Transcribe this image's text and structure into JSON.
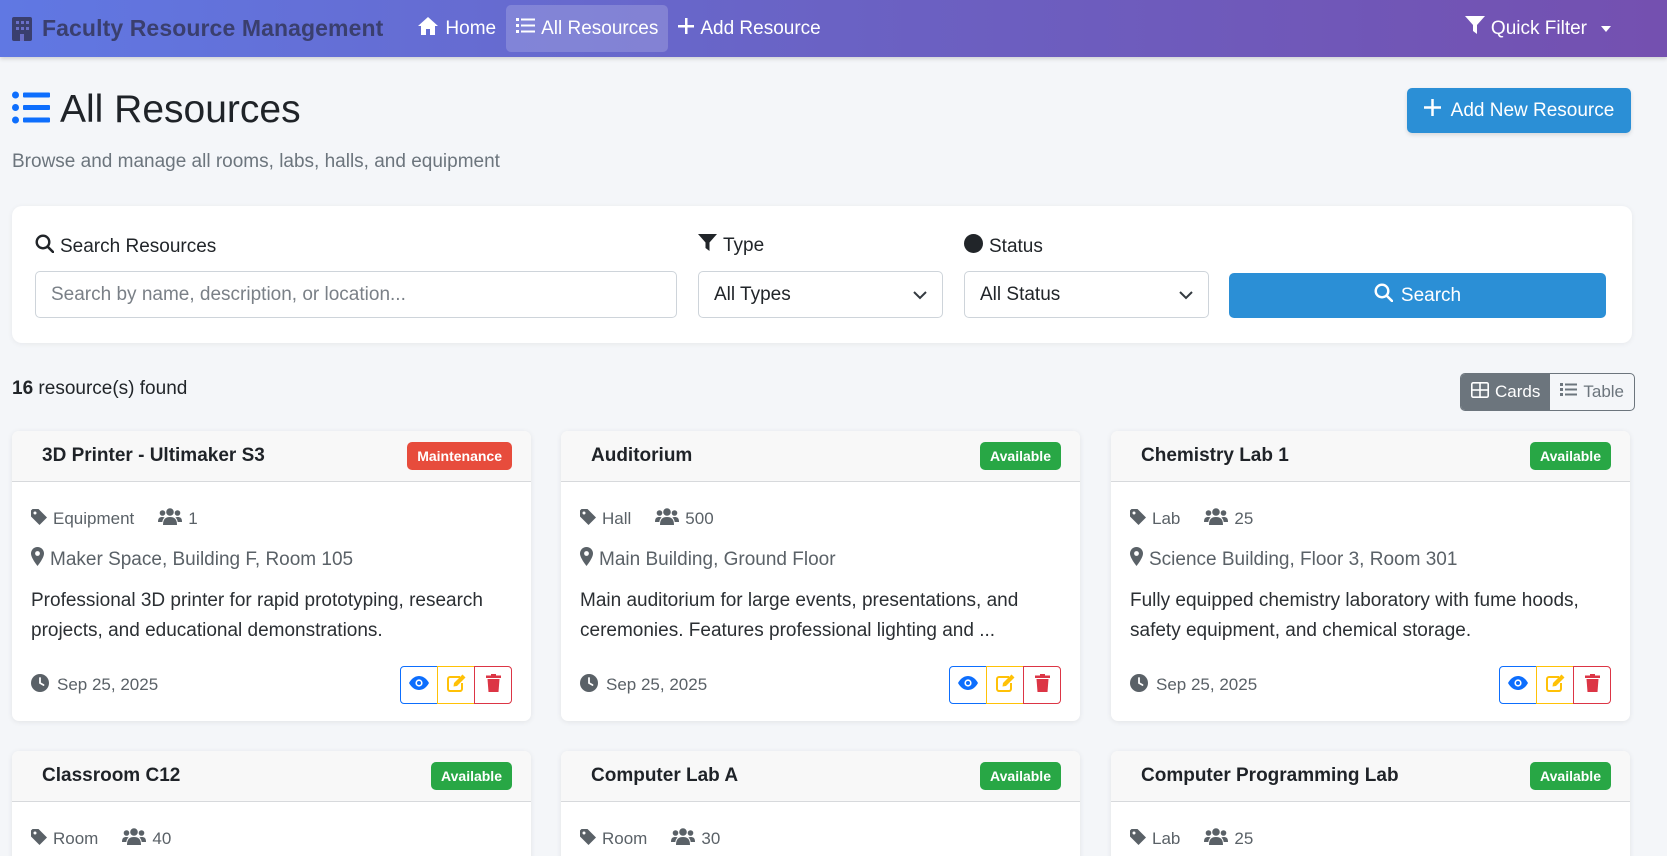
{
  "nav": {
    "brand": "Faculty Resource Management",
    "items": [
      {
        "label": "Home",
        "icon": "home-icon"
      },
      {
        "label": "All Resources",
        "icon": "list-icon"
      },
      {
        "label": "Add Resource",
        "icon": "plus-icon"
      }
    ],
    "quick_filter": "Quick Filter"
  },
  "header": {
    "title": "All Resources",
    "subtitle": "Browse and manage all rooms, labs, halls, and equipment",
    "add_button": "Add New Resource"
  },
  "filters": {
    "search_label": "Search Resources",
    "search_placeholder": "Search by name, description, or location...",
    "type_label": "Type",
    "type_value": "All Types",
    "status_label": "Status",
    "status_value": "All Status",
    "search_button": "Search"
  },
  "results": {
    "count": "16",
    "suffix": "resource(s) found",
    "view_cards": "Cards",
    "view_table": "Table"
  },
  "colors": {
    "accent": "#2b8fd6",
    "available": "#28a745",
    "maintenance": "#e74c3c"
  },
  "cards": [
    {
      "title": "3D Printer - Ultimaker S3",
      "status": "Maintenance",
      "type": "Equipment",
      "capacity": "1",
      "location": "Maker Space, Building F, Room 105",
      "description": "Professional 3D printer for rapid prototyping, research projects, and educational demonstrations.",
      "date": "Sep 25, 2025"
    },
    {
      "title": "Auditorium",
      "status": "Available",
      "type": "Hall",
      "capacity": "500",
      "location": "Main Building, Ground Floor",
      "description": "Main auditorium for large events, presentations, and ceremonies. Features professional lighting and ...",
      "date": "Sep 25, 2025"
    },
    {
      "title": "Chemistry Lab 1",
      "status": "Available",
      "type": "Lab",
      "capacity": "25",
      "location": "Science Building, Floor 3, Room 301",
      "description": "Fully equipped chemistry laboratory with fume hoods, safety equipment, and chemical storage.",
      "date": "Sep 25, 2025"
    },
    {
      "title": "Classroom C12",
      "status": "Available",
      "type": "Room",
      "capacity": "40"
    },
    {
      "title": "Computer Lab A",
      "status": "Available",
      "type": "Room",
      "capacity": "30"
    },
    {
      "title": "Computer Programming Lab",
      "status": "Available",
      "type": "Lab",
      "capacity": "25"
    }
  ]
}
